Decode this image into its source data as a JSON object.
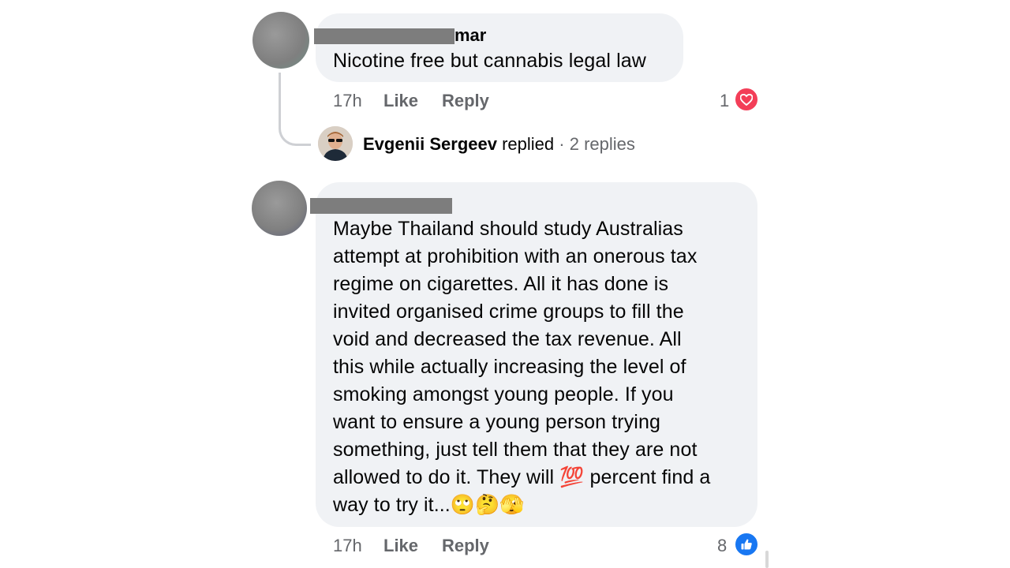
{
  "comment1": {
    "author_visible_suffix": "mar",
    "text": "Nicotine free but cannabis legal law",
    "time": "17h",
    "like_label": "Like",
    "reply_label": "Reply",
    "reaction_count": "1",
    "reaction_icon": "heart-icon",
    "reaction_color": "#f33e58",
    "replies": {
      "replier_name": "Evgenii Sergeev",
      "replied_label": "replied",
      "separator": "·",
      "replies_count": "2 replies"
    }
  },
  "comment2": {
    "text_lines": [
      "Maybe Thailand should study Australias",
      "attempt at prohibition with an onerous tax",
      "regime on cigarettes. All it has done is",
      "invited organised crime groups to fill the",
      "void and decreased the tax revenue. All",
      "this while actually increasing the level of",
      "smoking amongst young people. If you",
      "want to ensure a young person trying",
      "something, just tell them that they are not",
      "allowed to do it. They will",
      "percent find a",
      "way to try it..."
    ],
    "emoji_hundred": "💯",
    "emoji_end": "🙄🤔🫣",
    "time": "17h",
    "like_label": "Like",
    "reply_label": "Reply",
    "reaction_count": "8",
    "reaction_icon": "thumbs-up-icon",
    "reaction_color": "#1877f2"
  },
  "colors": {
    "bubble_bg": "#f0f2f5",
    "meta_text": "#65676b",
    "redaction": "#7d7d7d"
  }
}
